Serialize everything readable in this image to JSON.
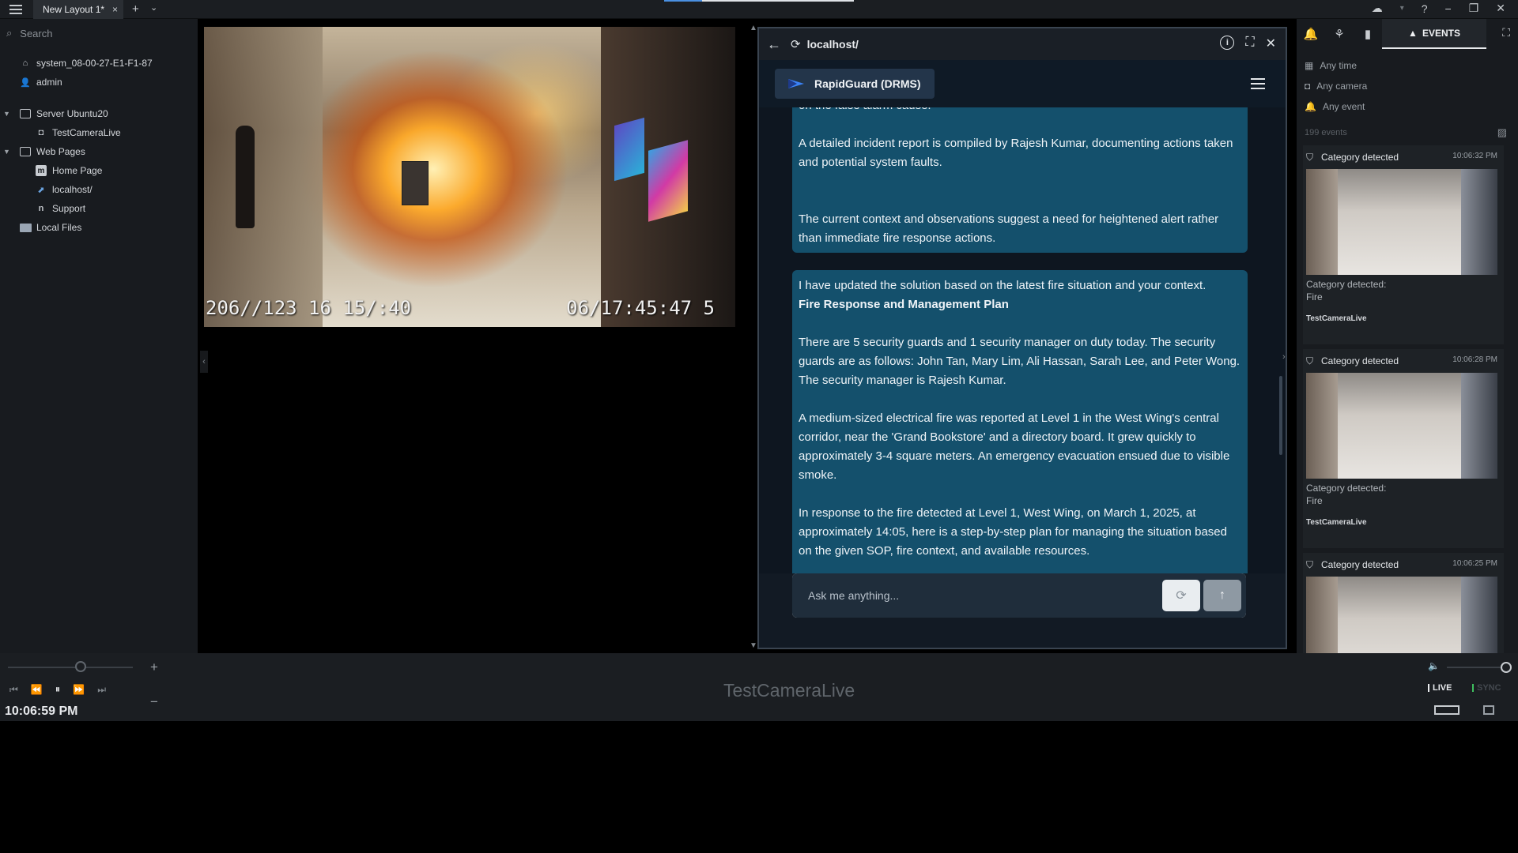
{
  "window": {
    "tab_label": "New Layout 1*",
    "tab_close": "×",
    "tab_add": "+",
    "tab_more": "⌄"
  },
  "leftpanel": {
    "search_placeholder": "Search",
    "tree": [
      {
        "label": "system_08-00-27-E1-F1-87",
        "icon": "home-icon"
      },
      {
        "label": "admin",
        "icon": "user-icon"
      },
      {
        "label": "Server Ubuntu20",
        "icon": "server-icon"
      },
      {
        "label": "TestCameraLive",
        "icon": "camera-icon"
      },
      {
        "label": "Web Pages",
        "icon": "webpages-icon"
      },
      {
        "label": "Home Page",
        "icon": "m-icon"
      },
      {
        "label": "localhost/",
        "icon": "link-icon"
      },
      {
        "label": "Support",
        "icon": "n-icon"
      },
      {
        "label": "Local Files",
        "icon": "folder-icon"
      }
    ]
  },
  "camera": {
    "timestamp_left": "206//123 16 15/:40",
    "timestamp_right": "06/17:45:47 5"
  },
  "browser": {
    "url": "localhost/",
    "brand": "RapidGuard (DRMS)",
    "messages": {
      "m1_cut": "on the false alarm cause.",
      "m1_p1": "A detailed incident report is compiled by Rajesh Kumar, documenting actions taken and potential system faults.",
      "m1_p2": "The current context and observations suggest a need for heightened alert rather than immediate fire response actions.",
      "m2_p1": "I have updated the solution based on the latest fire situation and your context.",
      "m2_heading": "Fire Response and Management Plan",
      "m2_p2": "There are 5 security guards and 1 security manager on duty today. The security guards are as follows: John Tan, Mary Lim, Ali Hassan, Sarah Lee, and Peter Wong. The security manager is Rajesh Kumar.",
      "m2_p3": "A medium-sized electrical fire was reported at Level 1 in the West Wing's central corridor, near the 'Grand Bookstore' and a directory board. It grew quickly to approximately 3-4 square meters. An emergency evacuation ensued due to visible smoke.",
      "m2_p4": "In response to the fire detected at Level 1, West Wing, on March 1, 2025, at approximately 14:05, here is a step-by-step plan for managing the situation based on the given SOP, fire context, and available resources."
    },
    "input_placeholder": "Ask me anything..."
  },
  "rightpanel": {
    "events_tab": "EVENTS",
    "filters": [
      "Any time",
      "Any camera",
      "Any event"
    ],
    "count": "199 events",
    "events": [
      {
        "title": "Category detected",
        "time": "10:06:32 PM",
        "desc1": "Category detected:",
        "desc2": "Fire",
        "camera": "TestCameraLive"
      },
      {
        "title": "Category detected",
        "time": "10:06:28 PM",
        "desc1": "Category detected:",
        "desc2": "Fire",
        "camera": "TestCameraLive"
      },
      {
        "title": "Category detected",
        "time": "10:06:25 PM",
        "desc1": "",
        "desc2": "",
        "camera": ""
      }
    ]
  },
  "bottombar": {
    "clock": "10:06:59 PM",
    "camera_name": "TestCameraLive",
    "live": "LIVE",
    "sync": "SYNC"
  }
}
